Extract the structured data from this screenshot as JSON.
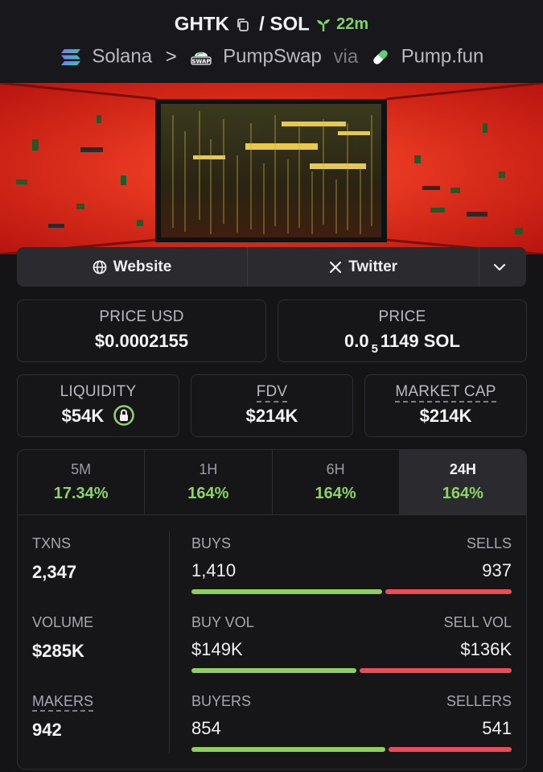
{
  "header": {
    "base_token": "GHTK",
    "quote_token": "SOL",
    "separator": "/",
    "age": "22m",
    "chain": "Solana",
    "dex": "PumpSwap",
    "via": "via",
    "launchpad": "Pump.fun"
  },
  "links": {
    "website": "Website",
    "twitter": "Twitter"
  },
  "stats": {
    "price_usd_label": "PRICE USD",
    "price_usd": "$0.0002155",
    "price_label": "PRICE",
    "price_native_prefix": "0.0",
    "price_native_zeros": "5",
    "price_native_rest": "1149 SOL",
    "liquidity_label": "LIQUIDITY",
    "liquidity": "$54K",
    "fdv_label": "FDV",
    "fdv": "$214K",
    "mcap_label": "MARKET CAP",
    "mcap": "$214K"
  },
  "timeframes": [
    {
      "label": "5M",
      "change": "17.34%"
    },
    {
      "label": "1H",
      "change": "164%"
    },
    {
      "label": "6H",
      "change": "164%"
    },
    {
      "label": "24H",
      "change": "164%"
    }
  ],
  "active_timeframe": "24H",
  "metrics": {
    "txns_label": "TXNS",
    "txns": "2,347",
    "volume_label": "VOLUME",
    "volume": "$285K",
    "makers_label": "MAKERS",
    "makers": "942"
  },
  "splits": {
    "buys_label": "BUYS",
    "buys": "1,410",
    "sells_label": "SELLS",
    "sells": "937",
    "buy_vol_label": "BUY VOL",
    "buy_vol": "$149K",
    "sell_vol_label": "SELL VOL",
    "sell_vol": "$136K",
    "buyers_label": "BUYERS",
    "buyers": "854",
    "sellers_label": "SELLERS",
    "sellers": "541"
  },
  "split_ratios": {
    "txns_buy_fraction": 0.6,
    "volume_buy_fraction": 0.52,
    "makers_buy_fraction": 0.61
  },
  "colors": {
    "positive": "#8fd16b",
    "buy_bar": "#8fcf5e",
    "sell_bar": "#ea4d55",
    "background": "#141417"
  },
  "icons": {
    "copy": "copy-icon",
    "age": "sprout-icon",
    "chain": "solana-icon",
    "dex": "pumpswap-icon",
    "launchpad": "pill-icon",
    "website": "globe-icon",
    "twitter": "x-icon",
    "more": "chevron-down-icon",
    "liquidity": "lock-icon"
  }
}
